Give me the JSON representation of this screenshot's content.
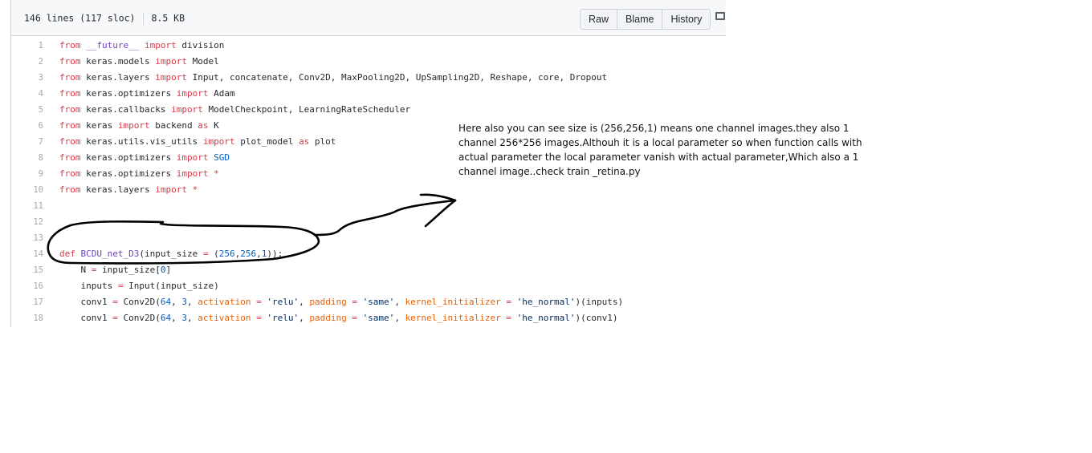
{
  "file_header": {
    "lines_info": "146 lines (117 sloc)",
    "size": "8.5 KB",
    "buttons": {
      "raw": "Raw",
      "blame": "Blame",
      "history": "History"
    }
  },
  "code_lines": [
    {
      "n": "1",
      "tokens": [
        [
          "k",
          "from"
        ],
        [
          "t",
          " "
        ],
        [
          "f",
          "__future__"
        ],
        [
          "t",
          " "
        ],
        [
          "k",
          "import"
        ],
        [
          "t",
          " division"
        ]
      ]
    },
    {
      "n": "2",
      "tokens": [
        [
          "k",
          "from"
        ],
        [
          "t",
          " keras.models "
        ],
        [
          "k",
          "import"
        ],
        [
          "t",
          " Model"
        ]
      ]
    },
    {
      "n": "3",
      "tokens": [
        [
          "k",
          "from"
        ],
        [
          "t",
          " keras.layers "
        ],
        [
          "k",
          "import"
        ],
        [
          "t",
          " Input, concatenate, Conv2D, MaxPooling2D, UpSampling2D, Reshape, core, Dropout"
        ]
      ]
    },
    {
      "n": "4",
      "tokens": [
        [
          "k",
          "from"
        ],
        [
          "t",
          " keras.optimizers "
        ],
        [
          "k",
          "import"
        ],
        [
          "t",
          " Adam"
        ]
      ]
    },
    {
      "n": "5",
      "tokens": [
        [
          "k",
          "from"
        ],
        [
          "t",
          " keras.callbacks "
        ],
        [
          "k",
          "import"
        ],
        [
          "t",
          " ModelCheckpoint, LearningRateScheduler"
        ]
      ]
    },
    {
      "n": "6",
      "tokens": [
        [
          "k",
          "from"
        ],
        [
          "t",
          " keras "
        ],
        [
          "k",
          "import"
        ],
        [
          "t",
          " backend "
        ],
        [
          "k",
          "as"
        ],
        [
          "t",
          " K"
        ]
      ]
    },
    {
      "n": "7",
      "tokens": [
        [
          "k",
          "from"
        ],
        [
          "t",
          " keras.utils.vis_utils "
        ],
        [
          "k",
          "import"
        ],
        [
          "t",
          " plot_model "
        ],
        [
          "k",
          "as"
        ],
        [
          "t",
          " plot"
        ]
      ]
    },
    {
      "n": "8",
      "tokens": [
        [
          "k",
          "from"
        ],
        [
          "t",
          " keras.optimizers "
        ],
        [
          "k",
          "import"
        ],
        [
          "t",
          " "
        ],
        [
          "n",
          "SGD"
        ]
      ]
    },
    {
      "n": "9",
      "tokens": [
        [
          "k",
          "from"
        ],
        [
          "t",
          " keras.optimizers "
        ],
        [
          "k",
          "import"
        ],
        [
          "t",
          " "
        ],
        [
          "o",
          "*"
        ]
      ]
    },
    {
      "n": "10",
      "tokens": [
        [
          "k",
          "from"
        ],
        [
          "t",
          " keras.layers "
        ],
        [
          "k",
          "import"
        ],
        [
          "t",
          " "
        ],
        [
          "o",
          "*"
        ]
      ]
    },
    {
      "n": "11",
      "tokens": []
    },
    {
      "n": "12",
      "tokens": []
    },
    {
      "n": "13",
      "tokens": []
    },
    {
      "n": "14",
      "tokens": [
        [
          "k",
          "def"
        ],
        [
          "t",
          " "
        ],
        [
          "f",
          "BCDU_net_D3"
        ],
        [
          "t",
          "(input_size "
        ],
        [
          "o",
          "="
        ],
        [
          "t",
          " ("
        ],
        [
          "n",
          "256"
        ],
        [
          "t",
          ","
        ],
        [
          "n",
          "256"
        ],
        [
          "t",
          ","
        ],
        [
          "n",
          "1"
        ],
        [
          "t",
          "))"
        ],
        [
          "t",
          ":"
        ]
      ]
    },
    {
      "n": "15",
      "tokens": [
        [
          "t",
          "    N "
        ],
        [
          "o",
          "="
        ],
        [
          "t",
          " input_size["
        ],
        [
          "n",
          "0"
        ],
        [
          "t",
          "]"
        ]
      ]
    },
    {
      "n": "16",
      "tokens": [
        [
          "t",
          "    inputs "
        ],
        [
          "o",
          "="
        ],
        [
          "t",
          " Input(input_size)"
        ]
      ]
    },
    {
      "n": "17",
      "tokens": [
        [
          "t",
          "    conv1 "
        ],
        [
          "o",
          "="
        ],
        [
          "t",
          " Conv2D("
        ],
        [
          "n",
          "64"
        ],
        [
          "t",
          ", "
        ],
        [
          "n",
          "3"
        ],
        [
          "t",
          ", "
        ],
        [
          "kw",
          "activation"
        ],
        [
          "t",
          " "
        ],
        [
          "o",
          "="
        ],
        [
          "t",
          " "
        ],
        [
          "s",
          "'relu'"
        ],
        [
          "t",
          ", "
        ],
        [
          "kw",
          "padding"
        ],
        [
          "t",
          " "
        ],
        [
          "o",
          "="
        ],
        [
          "t",
          " "
        ],
        [
          "s",
          "'same'"
        ],
        [
          "t",
          ", "
        ],
        [
          "kw",
          "kernel_initializer"
        ],
        [
          "t",
          " "
        ],
        [
          "o",
          "="
        ],
        [
          "t",
          " "
        ],
        [
          "s",
          "'he_normal'"
        ],
        [
          "t",
          ")(inputs)"
        ]
      ]
    },
    {
      "n": "18",
      "tokens": [
        [
          "t",
          "    conv1 "
        ],
        [
          "o",
          "="
        ],
        [
          "t",
          " Conv2D("
        ],
        [
          "n",
          "64"
        ],
        [
          "t",
          ", "
        ],
        [
          "n",
          "3"
        ],
        [
          "t",
          ", "
        ],
        [
          "kw",
          "activation"
        ],
        [
          "t",
          " "
        ],
        [
          "o",
          "="
        ],
        [
          "t",
          " "
        ],
        [
          "s",
          "'relu'"
        ],
        [
          "t",
          ", "
        ],
        [
          "kw",
          "padding"
        ],
        [
          "t",
          " "
        ],
        [
          "o",
          "="
        ],
        [
          "t",
          " "
        ],
        [
          "s",
          "'same'"
        ],
        [
          "t",
          ", "
        ],
        [
          "kw",
          "kernel_initializer"
        ],
        [
          "t",
          " "
        ],
        [
          "o",
          "="
        ],
        [
          "t",
          " "
        ],
        [
          "s",
          "'he_normal'"
        ],
        [
          "t",
          ")(conv1)"
        ]
      ]
    }
  ],
  "annotation": {
    "text": "Here also you can see size is (256,256,1) means one channel images.they also 1 channel 256*256 images.Althouh it is a local parameter so when function calls with actual parameter the local parameter vanish with actual parameter,Which also a 1 channel image..check train _retina.py"
  },
  "icons": {
    "desktop": "desktop-icon"
  }
}
